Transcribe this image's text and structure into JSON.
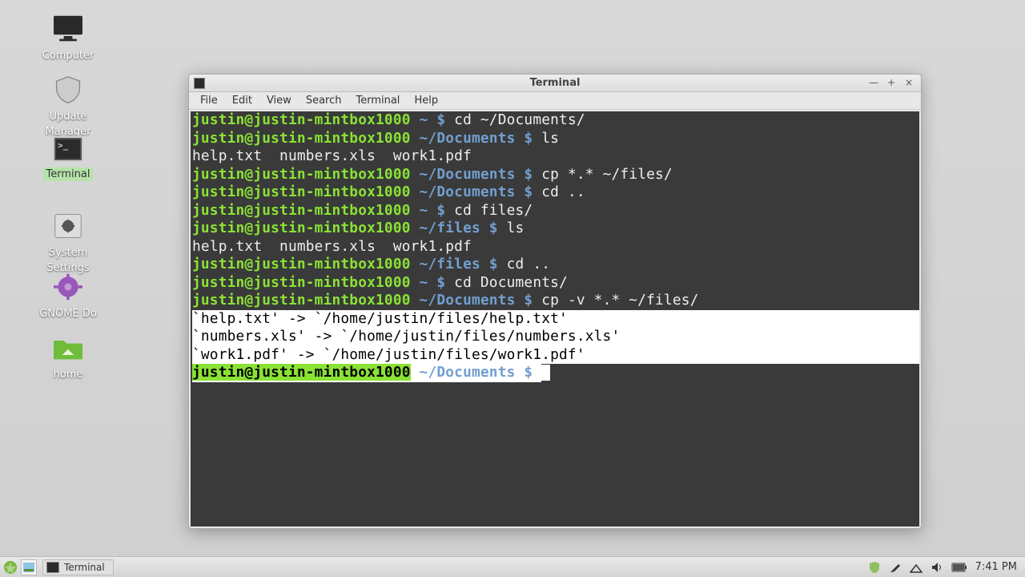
{
  "desktop": {
    "icons": [
      {
        "name": "computer",
        "label": "Computer"
      },
      {
        "name": "update-manager",
        "label": "Update Manager"
      },
      {
        "name": "terminal",
        "label": "Terminal"
      },
      {
        "name": "system-settings",
        "label": "System Settings"
      },
      {
        "name": "gnome-do",
        "label": "GNOME Do"
      },
      {
        "name": "home",
        "label": "home"
      }
    ]
  },
  "window": {
    "title": "Terminal",
    "menus": [
      "File",
      "Edit",
      "View",
      "Search",
      "Terminal",
      "Help"
    ]
  },
  "terminal": {
    "lines": [
      {
        "user": "justin@justin-mintbox1000",
        "path": "~",
        "sep": "$",
        "cmd": "cd ~/Documents/"
      },
      {
        "user": "justin@justin-mintbox1000",
        "path": "~/Documents",
        "sep": "$",
        "cmd": "ls"
      },
      {
        "out": "help.txt  numbers.xls  work1.pdf"
      },
      {
        "user": "justin@justin-mintbox1000",
        "path": "~/Documents",
        "sep": "$",
        "cmd": "cp *.* ~/files/"
      },
      {
        "user": "justin@justin-mintbox1000",
        "path": "~/Documents",
        "sep": "$",
        "cmd": "cd .."
      },
      {
        "user": "justin@justin-mintbox1000",
        "path": "~",
        "sep": "$",
        "cmd": "cd files/"
      },
      {
        "user": "justin@justin-mintbox1000",
        "path": "~/files",
        "sep": "$",
        "cmd": "ls"
      },
      {
        "out": "help.txt  numbers.xls  work1.pdf"
      },
      {
        "user": "justin@justin-mintbox1000",
        "path": "~/files",
        "sep": "$",
        "cmd": "cd .."
      },
      {
        "user": "justin@justin-mintbox1000",
        "path": "~",
        "sep": "$",
        "cmd": "cd Documents/"
      },
      {
        "user": "justin@justin-mintbox1000",
        "path": "~/Documents",
        "sep": "$",
        "cmd": "cp -v *.* ~/files/"
      },
      {
        "out": "`help.txt' -> `/home/justin/files/help.txt'",
        "sel": true
      },
      {
        "out": "`numbers.xls' -> `/home/justin/files/numbers.xls'",
        "sel": true
      },
      {
        "out": "`work1.pdf' -> `/home/justin/files/work1.pdf'",
        "sel": true
      },
      {
        "user": "justin@justin-mintbox1000",
        "path": "~/Documents",
        "sep": "$",
        "cmd": "",
        "final": true
      }
    ]
  },
  "taskbar": {
    "app_label": "Terminal",
    "clock": "7:41 PM"
  }
}
